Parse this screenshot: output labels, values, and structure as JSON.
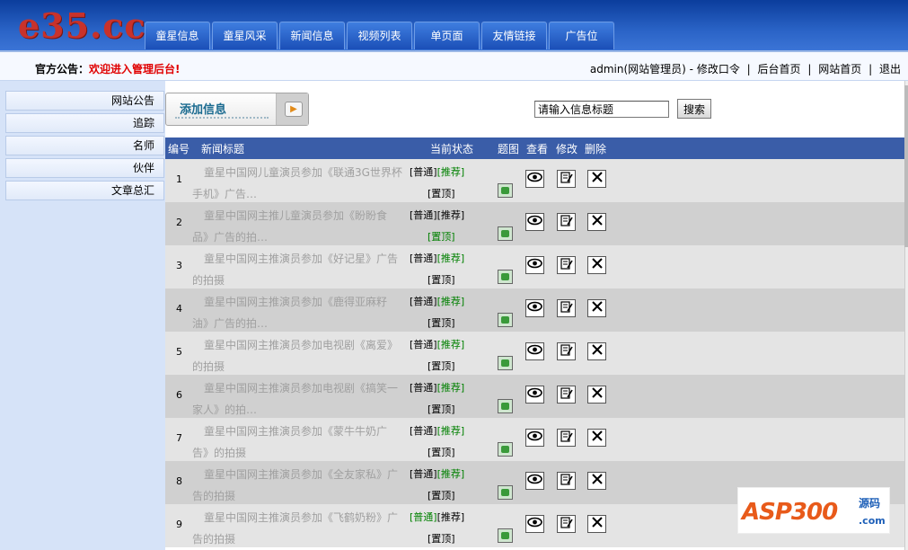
{
  "header": {
    "logo": "e35.cc",
    "tabs": [
      "童星信息",
      "童星风采",
      "新闻信息",
      "视频列表",
      "单页面",
      "友情链接",
      "广告位"
    ]
  },
  "notice": {
    "label": "官方公告：",
    "message": "欢迎进入管理后台!"
  },
  "user_links": {
    "user": "admin(网站管理员)",
    "dash": "-",
    "change_password": "修改口令",
    "sep": "|",
    "admin_home": "后台首页",
    "site_home": "网站首页",
    "logout": "退出"
  },
  "sidebar": {
    "items": [
      "网站公告",
      "追踪",
      "名师",
      "伙伴",
      "文章总汇"
    ]
  },
  "toolbar": {
    "add_label": "添加信息",
    "add_arrow": "▶",
    "search_placeholder": "请输入信息标题",
    "search_label": "搜索"
  },
  "table": {
    "headers": {
      "num": "编号",
      "title": "新闻标题",
      "status": "当前状态",
      "image": "题图",
      "view": "查看",
      "edit": "修改",
      "delete": "删除"
    },
    "rows": [
      {
        "num": "1",
        "title": "童星中国网儿童演员参加《联通3G世界杯手机》广告…",
        "normal": "[普通]",
        "recommend": "[推荐]",
        "top": "[置顶]"
      },
      {
        "num": "2",
        "title": "童星中国网主推儿童演员参加《盼盼食品》广告的拍…",
        "normal": "[普通]",
        "recommend": "[推荐]",
        "top": "[置顶]"
      },
      {
        "num": "3",
        "title": "童星中国网主推演员参加《好记星》广告的拍摄",
        "normal": "[普通]",
        "recommend": "[推荐]",
        "top": "[置顶]"
      },
      {
        "num": "4",
        "title": "童星中国网主推演员参加《鹿得亚麻籽油》广告的拍…",
        "normal": "[普通]",
        "recommend": "[推荐]",
        "top": "[置顶]"
      },
      {
        "num": "5",
        "title": "童星中国网主推演员参加电视剧《离爱》的拍摄",
        "normal": "[普通]",
        "recommend": "[推荐]",
        "top": "[置顶]"
      },
      {
        "num": "6",
        "title": "童星中国网主推演员参加电视剧《搞笑一家人》的拍…",
        "normal": "[普通]",
        "recommend": "[推荐]",
        "top": "[置顶]"
      },
      {
        "num": "7",
        "title": "童星中国网主推演员参加《蒙牛牛奶广告》的拍摄",
        "normal": "[普通]",
        "recommend": "[推荐]",
        "top": "[置顶]"
      },
      {
        "num": "8",
        "title": "童星中国网主推演员参加《全友家私》广告的拍摄",
        "normal": "[普通]",
        "recommend": "[推荐]",
        "top": "[置顶]"
      },
      {
        "num": "9",
        "title": "童星中国网主推演员参加《飞鹤奶粉》广告的拍摄",
        "normal": "[普通]",
        "recommend": "[推荐]",
        "top": "[置顶]"
      }
    ],
    "icons": {
      "view": "eye-icon",
      "edit": "edit-icon",
      "delete": "delete-x-icon",
      "image": "image-icon"
    }
  },
  "watermark": {
    "logo": "ASP300",
    "side": "源码",
    "com": ".com"
  },
  "colors": {
    "header_blue": "#1b4fb7",
    "table_head": "#3a5da8",
    "notice_red": "#e00000",
    "status_green": "#008000"
  }
}
